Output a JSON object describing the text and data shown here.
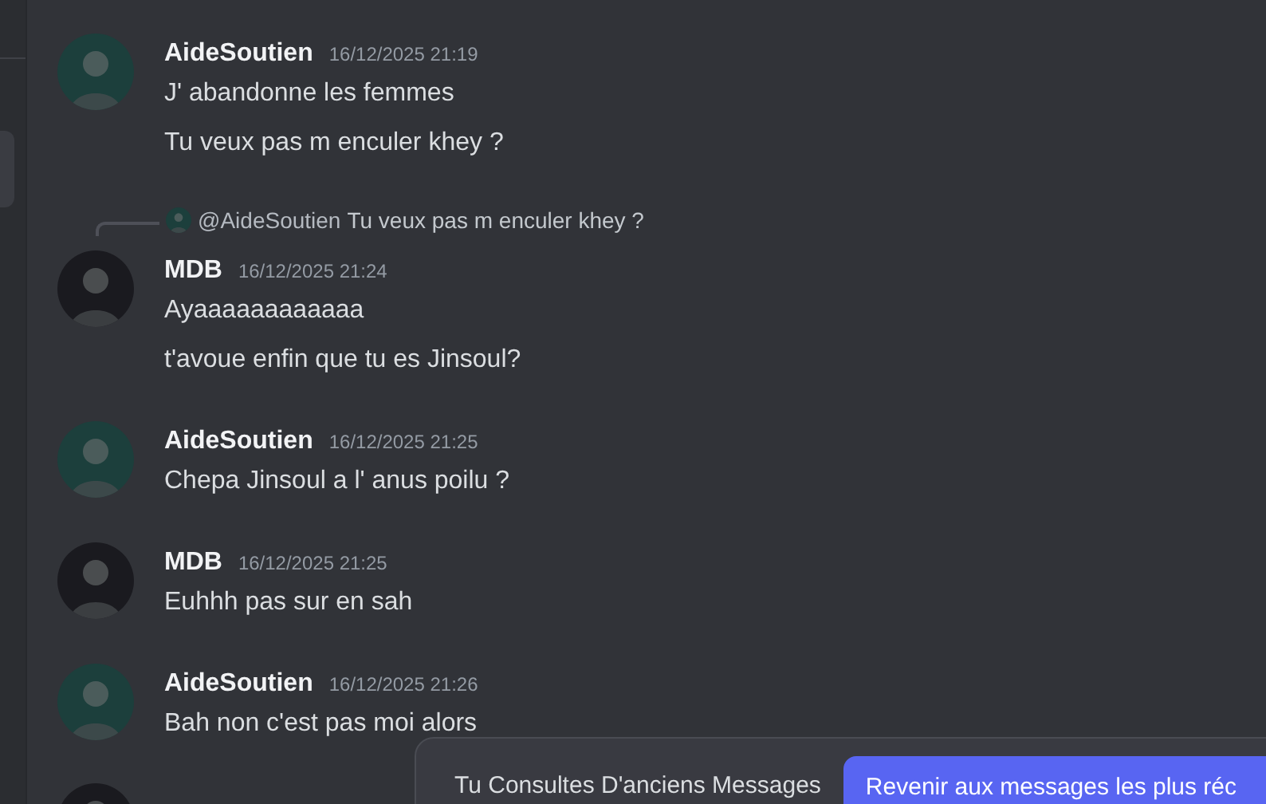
{
  "messages": [
    {
      "author": "AideSoutien",
      "color": "#1c3f3c",
      "time": "16/12/2025 21:19",
      "lines": [
        "J' abandonne les femmes",
        "Tu veux pas m enculer khey ?"
      ]
    },
    {
      "author": "MDB",
      "color": "#1a1a1f",
      "time": "16/12/2025 21:24",
      "reply": {
        "mention": "@AideSoutien",
        "text": "Tu veux pas m enculer khey ?"
      },
      "lines": [
        "Ayaaaaaaaaaaaa",
        "t'avoue enfin que tu es Jinsoul?"
      ]
    },
    {
      "author": "AideSoutien",
      "color": "#1c3f3c",
      "time": "16/12/2025 21:25",
      "lines": [
        "Chepa Jinsoul a l' anus poilu ?"
      ]
    },
    {
      "author": "MDB",
      "color": "#1a1a1f",
      "time": "16/12/2025 21:25",
      "lines": [
        "Euhhh pas sur en sah"
      ]
    },
    {
      "author": "AideSoutien",
      "color": "#1c3f3c",
      "time": "16/12/2025 21:26",
      "lines": [
        "Bah non c'est pas moi alors"
      ]
    }
  ],
  "notice_bar": {
    "text": "Tu Consultes D'anciens Messages",
    "button": "Revenir aux messages les plus réc"
  }
}
